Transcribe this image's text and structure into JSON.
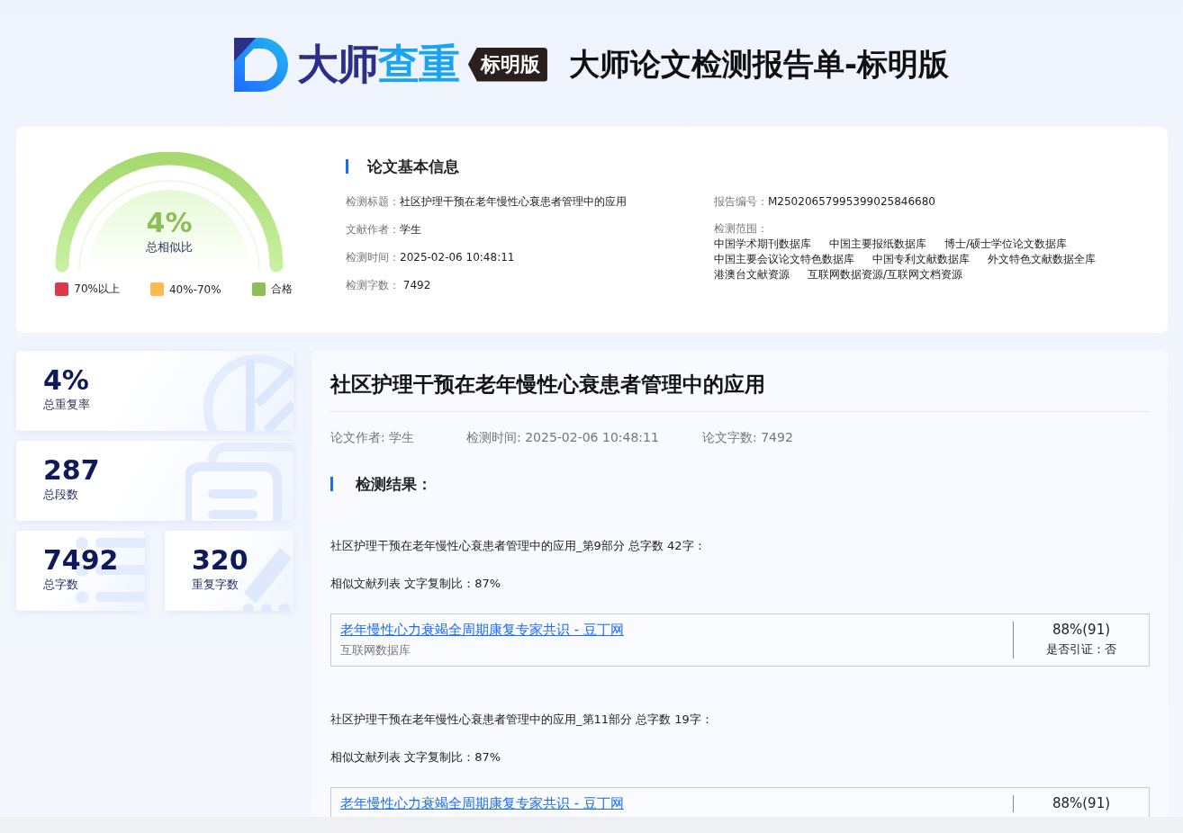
{
  "header": {
    "logo_text": [
      "大师",
      "查重"
    ],
    "edition_badge": "标明版",
    "title": "大师论文检测报告单-标明版"
  },
  "summary": {
    "gauge": {
      "value": "4%",
      "label": "总相似比"
    },
    "legend": [
      {
        "label": "70%以上",
        "color": "#dc3a4b"
      },
      {
        "label": "40%-70%",
        "color": "#ffb950"
      },
      {
        "label": "合格",
        "color": "#8cbf55"
      }
    ]
  },
  "basic_info": {
    "heading": "论文基本信息",
    "fields": [
      {
        "label": "检测标题：",
        "value": "社区护理干预在老年慢性心衰患者管理中的应用"
      },
      {
        "label": "文献作者：",
        "value": "学生"
      },
      {
        "label": "检测时间：",
        "value": "2025-02-06 10:48:11"
      },
      {
        "label": "检测字数：",
        "value": " 7492"
      }
    ],
    "report_no": {
      "label": "报告编号：",
      "value": "M25020657995399025846680"
    },
    "scope": {
      "label": "检测范围：",
      "items": [
        "中国学术期刊数据库",
        "中国主要报纸数据库",
        "博士/硕士学位论文数据库",
        "中国主要会议论文特色数据库",
        "中国专利文献数据库",
        "外文特色文献数据全库",
        "港澳台文献资源",
        "互联网数据资源/互联网文档资源"
      ]
    }
  },
  "stats": [
    {
      "value": "4%",
      "label": "总重复率",
      "kind": "pie"
    },
    {
      "value": "287",
      "label": "总段数",
      "kind": "document"
    },
    {
      "value": "7492",
      "label": "总字数",
      "kind": "list"
    },
    {
      "value": "320",
      "label": "重复字数",
      "kind": "pencil"
    }
  ],
  "paper": {
    "title": "社区护理干预在老年慢性心衰患者管理中的应用",
    "meta": [
      "论文作者: 学生",
      "检测时间: 2025-02-06 10:48:11",
      "论文字数: 7492"
    ],
    "results_heading": "检测结果：",
    "segments": [
      {
        "heading": "社区护理干预在老年慢性心衰患者管理中的应用_第9部分 总字数 42字：",
        "ratio": "相似文献列表 文字复制比：87%",
        "sources": [
          {
            "title": "老年慢性心力衰竭全周期康复专家共识 - 豆丁网",
            "database": "互联网数据库",
            "score": "88%(91)",
            "cited": "是否引证：否"
          }
        ]
      },
      {
        "heading": "社区护理干预在老年慢性心衰患者管理中的应用_第11部分 总字数 19字：",
        "ratio": "相似文献列表 文字复制比：87%",
        "sources": [
          {
            "title": "老年慢性心力衰竭全周期康复专家共识 - 豆丁网",
            "score": "88%(91)"
          }
        ]
      }
    ]
  }
}
